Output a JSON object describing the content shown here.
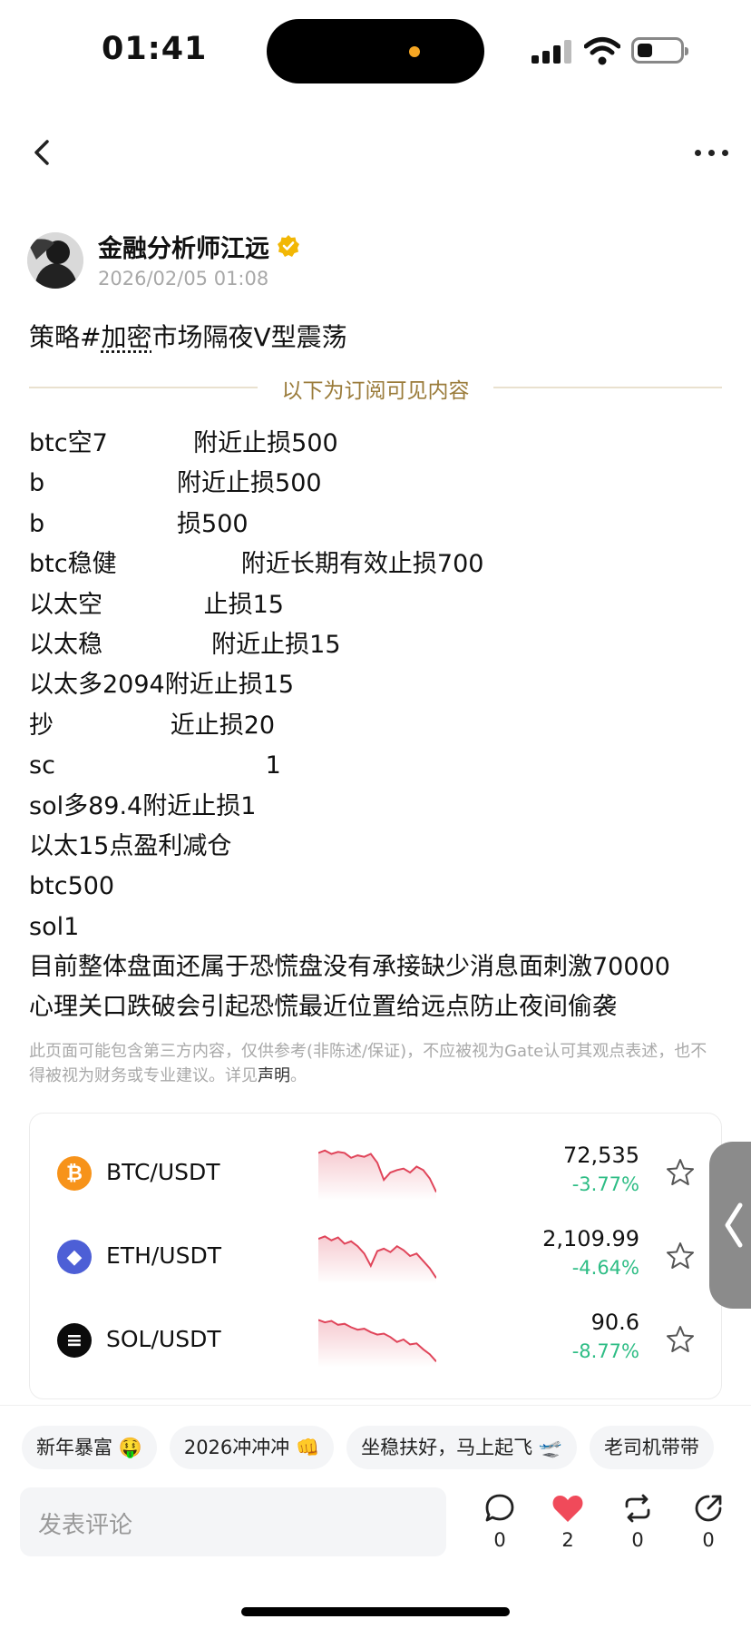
{
  "status_bar": {
    "time": "01:41"
  },
  "post": {
    "author": "金融分析师江远",
    "timestamp": "2026/02/05 01:08",
    "title_prefix": "策略#",
    "title_link": "加密",
    "title_rest": "市场隔夜V型震荡",
    "divider_label": "以下为订阅可见内容",
    "lines": [
      {
        "a": "btc空7",
        "b": "           ",
        "c": "附近止损500"
      },
      {
        "a": "b",
        "b": "                 ",
        "c": "附近止损500"
      },
      {
        "a": "b",
        "b": "                 ",
        "c": "损500"
      },
      {
        "a": "btc稳健",
        "b": "                ",
        "c": "附近长期有效止损700"
      },
      {
        "a": "以太空",
        "b": "             ",
        "c": "止损15"
      },
      {
        "a": "以太稳",
        "b": "              ",
        "c": "附近止损15"
      },
      {
        "a": "以太多2094附近止损15",
        "b": "",
        "c": ""
      },
      {
        "a": "抄",
        "b": "               ",
        "c": "近止损20"
      },
      {
        "a": "sc",
        "b": "                           ",
        "c": "1"
      },
      {
        "a": "sol多89.4附近止损1",
        "b": "",
        "c": ""
      },
      {
        "a": "以太15点盈利减仓",
        "b": "",
        "c": ""
      },
      {
        "a": "btc500",
        "b": "",
        "c": ""
      },
      {
        "a": "sol1",
        "b": "",
        "c": ""
      },
      {
        "a": "目前整体盘面还属于恐慌盘没有承接缺少消息面刺激70000",
        "b": "",
        "c": ""
      },
      {
        "a": "心理关口跌破会引起恐慌最近位置给远点防止夜间偷袭",
        "b": "",
        "c": ""
      }
    ],
    "disclaimer": "此页面可能包含第三方内容，仅供参考(非陈述/保证)，不应被视为Gate认可其观点表述，也不得被视为财务或专业建议。详见",
    "disclaimer_link": "声明",
    "disclaimer_end": "。"
  },
  "markets": [
    {
      "pair": "BTC/USDT",
      "price": "72,535",
      "change": "-3.77%",
      "icon": "bitcoin-icon",
      "color": "#f7931a",
      "glyph": "₿"
    },
    {
      "pair": "ETH/USDT",
      "price": "2,109.99",
      "change": "-4.64%",
      "icon": "ethereum-icon",
      "color": "#4d5fd6",
      "glyph": "◆"
    },
    {
      "pair": "SOL/USDT",
      "price": "90.6",
      "change": "-8.77%",
      "icon": "solana-icon",
      "color": "#0b0b0b",
      "glyph": "≡"
    }
  ],
  "topics": [
    "新年暴富 🤑",
    "2026冲冲冲 👊",
    "坐稳扶好，马上起飞 🛫",
    "老司机带带"
  ],
  "comment": {
    "placeholder": "发表评论",
    "counts": {
      "comment": "0",
      "like": "2",
      "repost": "0",
      "share": "0"
    }
  },
  "colors": {
    "accent_gold": "#9a7b3a",
    "down_change": "#2ebd85",
    "like_red": "#f04a5a",
    "spark_red": "#e0455a"
  }
}
